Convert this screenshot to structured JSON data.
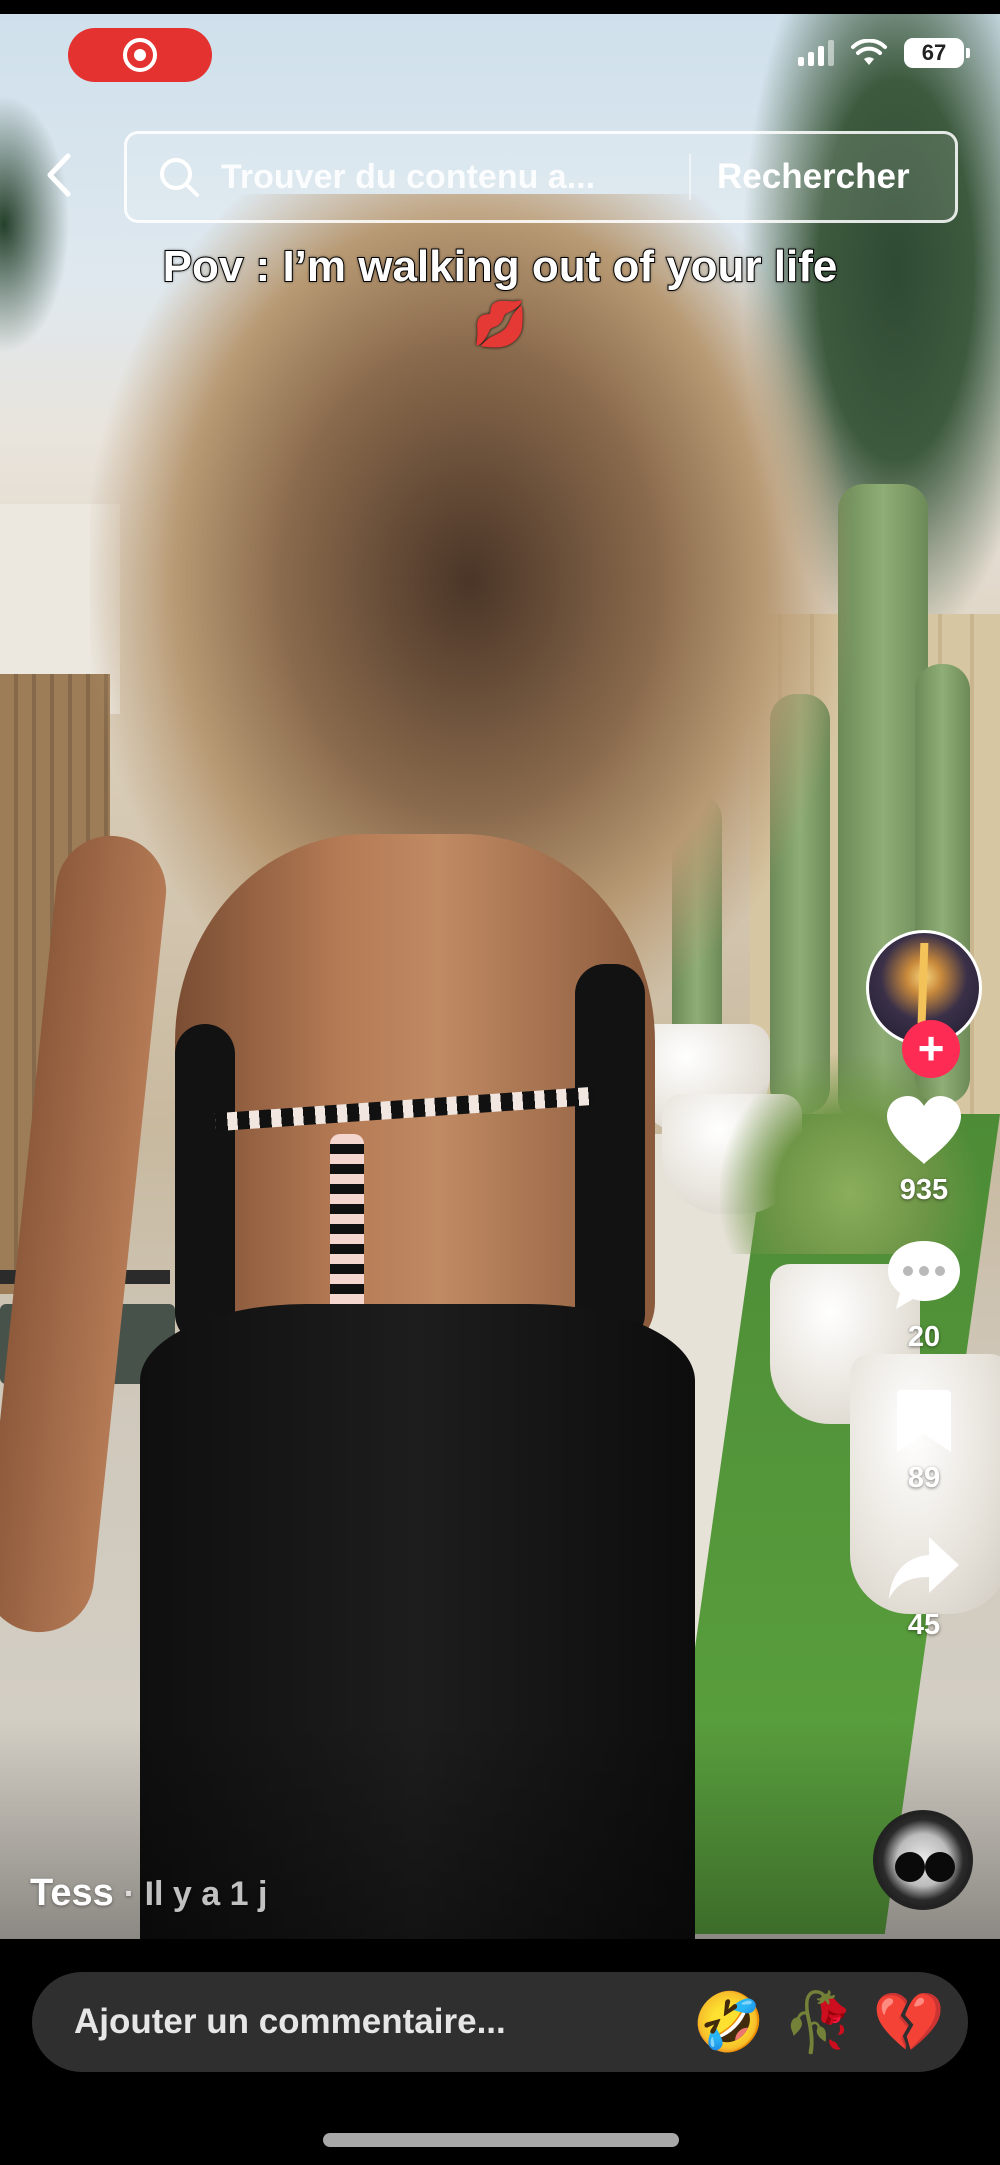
{
  "status_bar": {
    "battery": "67",
    "record_icon": "record-icon",
    "signal_icon": "signal-icon",
    "wifi_icon": "wifi-icon"
  },
  "header": {
    "back_icon": "chevron-left-icon",
    "search_placeholder": "Trouver du contenu a...",
    "search_button": "Rechercher"
  },
  "video": {
    "caption": "Pov : I’m walking out of your life 💋",
    "author": "Tess",
    "posted": "· Il y a 1 j"
  },
  "actions": {
    "likes": "935",
    "comments": "20",
    "saves": "89",
    "shares": "45",
    "follow_icon": "plus-icon"
  },
  "comment": {
    "placeholder": "Ajouter un commentaire...",
    "quick_emojis": [
      "🤣",
      "🥀",
      "💔"
    ]
  },
  "colors": {
    "accent": "#fe2c55",
    "record": "#e3322f",
    "bar": "#2f2f2f"
  }
}
